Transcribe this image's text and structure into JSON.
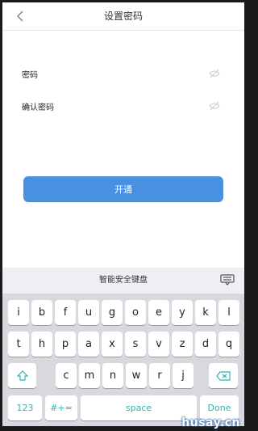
{
  "header": {
    "title": "设置密码"
  },
  "form": {
    "password_label": "密码",
    "confirm_label": "确认密码",
    "submit_label": "开通"
  },
  "keyboard": {
    "title": "智能安全键盘",
    "row1": [
      "i",
      "b",
      "f",
      "u",
      "g",
      "o",
      "e",
      "y",
      "k",
      "l"
    ],
    "row2": [
      "t",
      "h",
      "p",
      "a",
      "x",
      "s",
      "v",
      "z",
      "d",
      "q"
    ],
    "row3": [
      "c",
      "m",
      "n",
      "w",
      "r",
      "j"
    ],
    "numeric_label": "123",
    "symbol_label": "#+=",
    "space_label": "space",
    "done_label": "Done",
    "accent_color": "#2fb4b0"
  },
  "watermark": "husay.cn"
}
